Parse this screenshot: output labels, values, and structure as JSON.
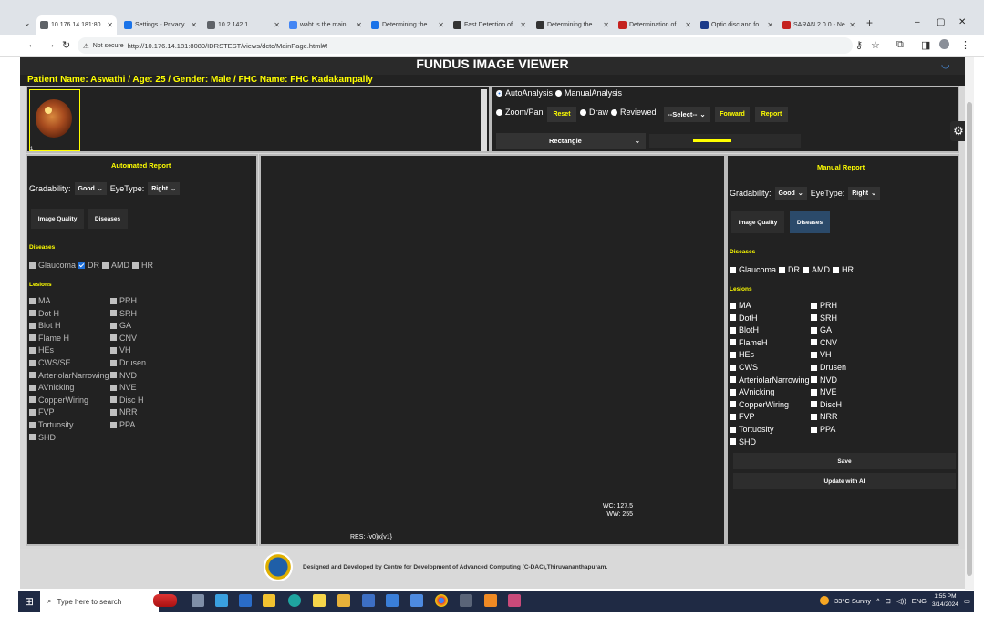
{
  "browser": {
    "tabs": [
      {
        "label": "10.176.14.181:80",
        "color": "#5f6368",
        "active": true
      },
      {
        "label": "Settings - Privacy",
        "color": "#1a73e8",
        "active": false
      },
      {
        "label": "10.2.142.1",
        "color": "#5f6368",
        "active": false
      },
      {
        "label": "waht is the main",
        "color": "#4285f4",
        "active": false
      },
      {
        "label": "Determining the",
        "color": "#1a73e8",
        "active": false
      },
      {
        "label": "Fast Detection of",
        "color": "#333333",
        "active": false
      },
      {
        "label": "Determining the",
        "color": "#333333",
        "active": false
      },
      {
        "label": "Determination of",
        "color": "#c5221f",
        "active": false
      },
      {
        "label": "Optic disc and fo",
        "color": "#1a3a8a",
        "active": false
      },
      {
        "label": "SARAN 2.0.0 - Ne",
        "color": "#c5221f",
        "active": false
      }
    ],
    "not_secure": "Not secure",
    "url": "http://10.176.14.181:8080/IDRSTEST/views/dctc/MainPage.html#!"
  },
  "app": {
    "title": "FUNDUS IMAGE VIEWER",
    "patient": "Patient Name: Aswathi / Age: 25 / Gender: Male / FHC Name: FHC Kadakampally",
    "thumb_index": "1"
  },
  "controls": {
    "auto_analysis": "AutoAnalysis",
    "manual_analysis": "ManualAnalysis",
    "zoom_pan": "Zoom/Pan",
    "reset": "Reset",
    "draw": "Draw",
    "reviewed": "Reviewed",
    "select": "--Select--",
    "forward": "Forward",
    "report": "Report",
    "shape": "Rectangle",
    "color_swatch": "#ffff00"
  },
  "auto_report": {
    "title": "Automated Report",
    "gradability_label": "Gradability:",
    "gradability_value": "Good",
    "eyetype_label": "EyeType:",
    "eyetype_value": "Right",
    "tab_image_quality": "Image Quality",
    "tab_diseases": "Diseases",
    "diseases_title": "Diseases",
    "diseases": [
      {
        "label": "Glaucoma",
        "checked": false
      },
      {
        "label": "DR",
        "checked": true
      },
      {
        "label": "AMD",
        "checked": false
      },
      {
        "label": "HR",
        "checked": false
      }
    ],
    "lesions_title": "Lesions",
    "lesions_left": [
      "MA",
      "Dot H",
      "Blot H",
      "Flame H",
      "HEs",
      "CWS/SE",
      "ArteriolarNarrowing",
      "AVnicking",
      "CopperWiring",
      "FVP",
      "Tortuosity",
      "SHD"
    ],
    "lesions_right": [
      "PRH",
      "SRH",
      "GA",
      "CNV",
      "VH",
      "Drusen",
      "NVD",
      "NVE",
      "Disc H",
      "NRR",
      "PPA"
    ]
  },
  "viewer": {
    "wc": "WC: 127.5",
    "ww": "WW: 255",
    "res": "RES: {v0}x{v1}"
  },
  "manual_report": {
    "title": "Manual Report",
    "gradability_label": "Gradability:",
    "gradability_value": "Good",
    "eyetype_label": "EyeType:",
    "eyetype_value": "Right",
    "tab_image_quality": "Image Quality",
    "tab_diseases": "Diseases",
    "diseases_title": "Diseases",
    "diseases": [
      {
        "label": "Glaucoma",
        "checked": false
      },
      {
        "label": "DR",
        "checked": false
      },
      {
        "label": "AMD",
        "checked": false
      },
      {
        "label": "HR",
        "checked": false
      }
    ],
    "lesions_title": "Lesions",
    "lesions_left": [
      "MA",
      "DotH",
      "BlotH",
      "FlameH",
      "HEs",
      "CWS",
      "ArteriolarNarrowing",
      "AVnicking",
      "CopperWiring",
      "FVP",
      "Tortuosity",
      "SHD"
    ],
    "lesions_right": [
      "PRH",
      "SRH",
      "GA",
      "CNV",
      "VH",
      "Drusen",
      "NVD",
      "NVE",
      "DiscH",
      "NRR",
      "PPA"
    ],
    "save": "Save",
    "update_ai": "Update with AI"
  },
  "footer": {
    "text": "Designed and Developed by Centre for Development of Advanced Computing (C-DAC),Thiruvananthapuram."
  },
  "taskbar": {
    "search_placeholder": "Type here to search",
    "weather": "33°C  Sunny",
    "lang": "ENG",
    "time": "1:55 PM",
    "date": "3/14/2024"
  }
}
